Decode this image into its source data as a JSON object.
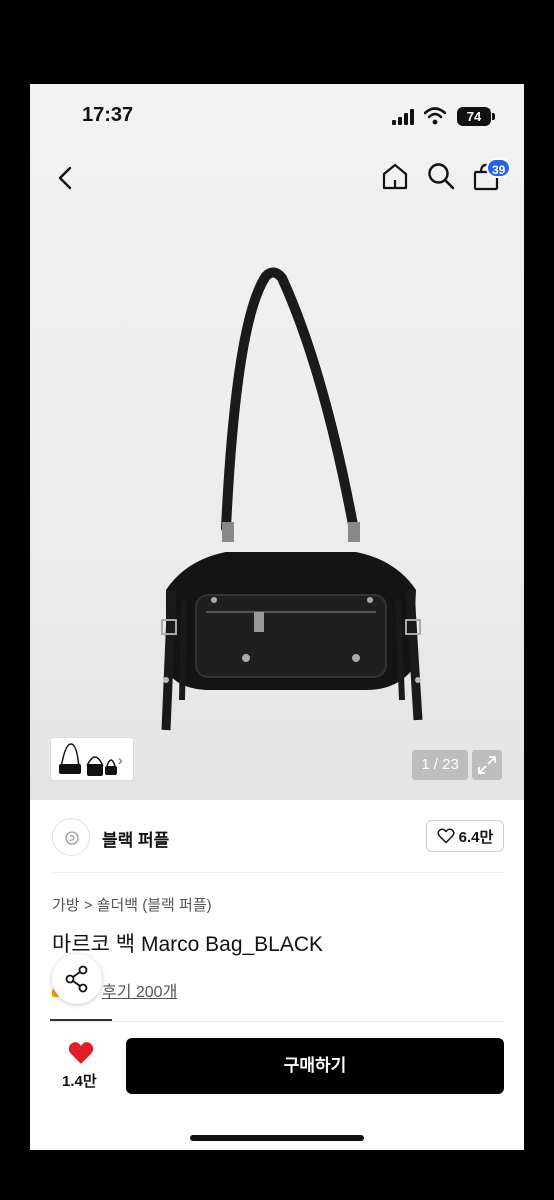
{
  "status": {
    "time": "17:37",
    "battery": "74"
  },
  "header": {
    "cart_count": "39"
  },
  "gallery": {
    "counter": "1 / 23"
  },
  "brand": {
    "name": "블랙 퍼플",
    "likes": "6.4만"
  },
  "product": {
    "breadcrumb": "가방 > 숄더백 (블랙 퍼플)",
    "title": "마르코 백 Marco Bag_BLACK",
    "reviews": "후기 200개"
  },
  "bottom": {
    "likes": "1.4만",
    "buy_label": "구매하기"
  },
  "colors": {
    "accent": "#2563eb",
    "like_red": "#e11d2a",
    "buy_bg": "#000000"
  }
}
